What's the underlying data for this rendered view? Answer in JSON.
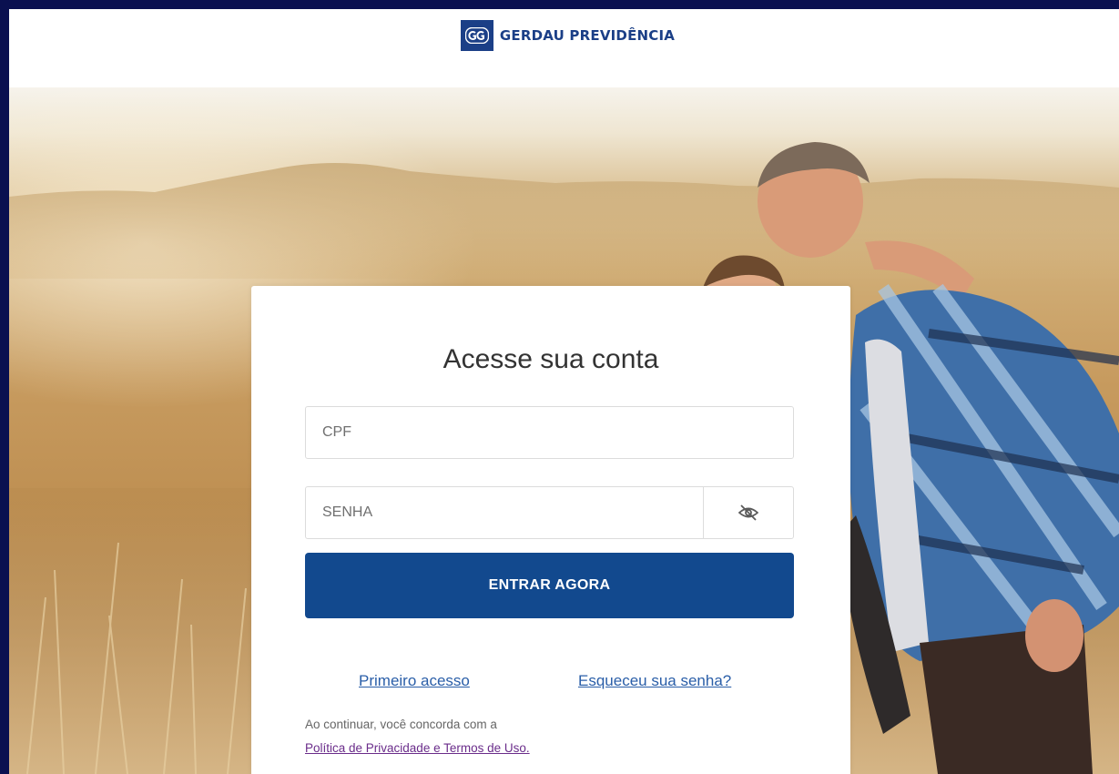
{
  "header": {
    "logo_mark": "GG",
    "logo_text": "GERDAU PREVIDÊNCIA"
  },
  "login": {
    "title": "Acesse sua conta",
    "cpf_placeholder": "CPF",
    "senha_placeholder": "SENHA",
    "submit_label": "ENTRAR AGORA",
    "primeiro_acesso_label": "Primeiro acesso",
    "esqueceu_senha_label": "Esqueceu sua senha?",
    "terms_prefix": "Ao continuar, você concorda com a",
    "terms_link_label": "Política de Privacidade e Termos de Uso."
  },
  "icons": {
    "password_toggle": "eye-slash-icon"
  },
  "colors": {
    "brand": "#1b3f87",
    "button": "#12498e",
    "link": "#2a5ea8",
    "terms_link": "#6a2c8a",
    "outer_frame": "#0a1050"
  }
}
